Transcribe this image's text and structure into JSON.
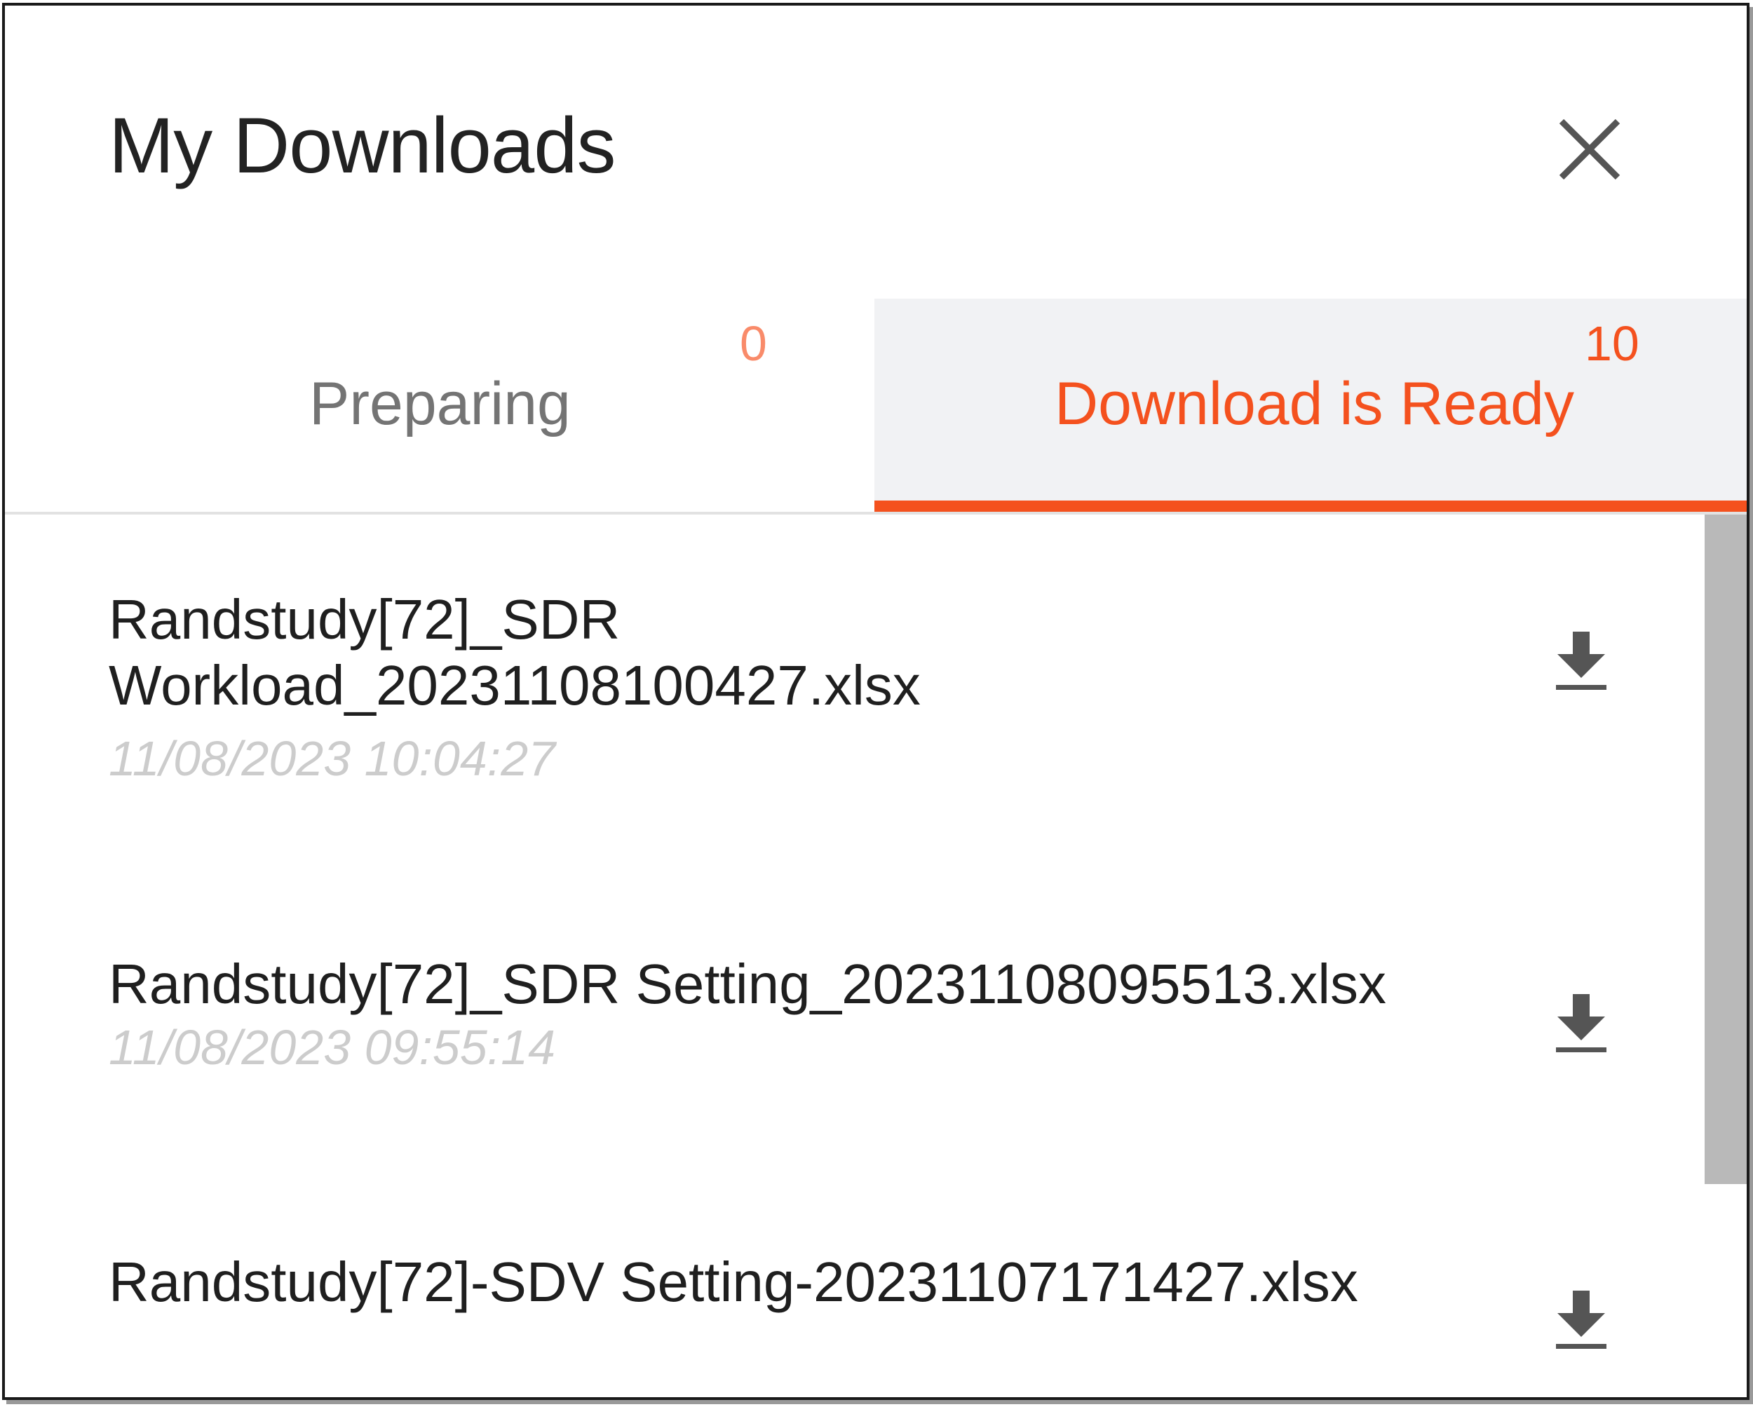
{
  "dialog": {
    "title": "My Downloads",
    "close_icon": "close-icon"
  },
  "tabs": [
    {
      "label": "Preparing",
      "count": "0",
      "active": false
    },
    {
      "label": "Download is Ready",
      "count": "10",
      "active": true
    }
  ],
  "downloads": [
    {
      "name_line1": "Randstudy[72]_SDR",
      "name_line2": "Workload_20231108100427.xlsx",
      "date": "11/08/2023 10:04:27",
      "action_icon": "download-icon"
    },
    {
      "name_line1": "Randstudy[72]_SDR Setting_20231108095513.xlsx",
      "date": "11/08/2023 09:55:14",
      "action_icon": "download-icon"
    },
    {
      "name_line1": "Randstudy[72]-SDV Setting-20231107171427.xlsx",
      "action_icon": "download-icon"
    }
  ],
  "colors": {
    "accent": "#f4511e",
    "accent_light": "#f98b6a",
    "active_tab_bg": "#f1f2f4",
    "title_text": "#222222",
    "muted_text": "#cccccc",
    "icon": "#555555",
    "scroll_thumb": "#b9b9b9"
  }
}
